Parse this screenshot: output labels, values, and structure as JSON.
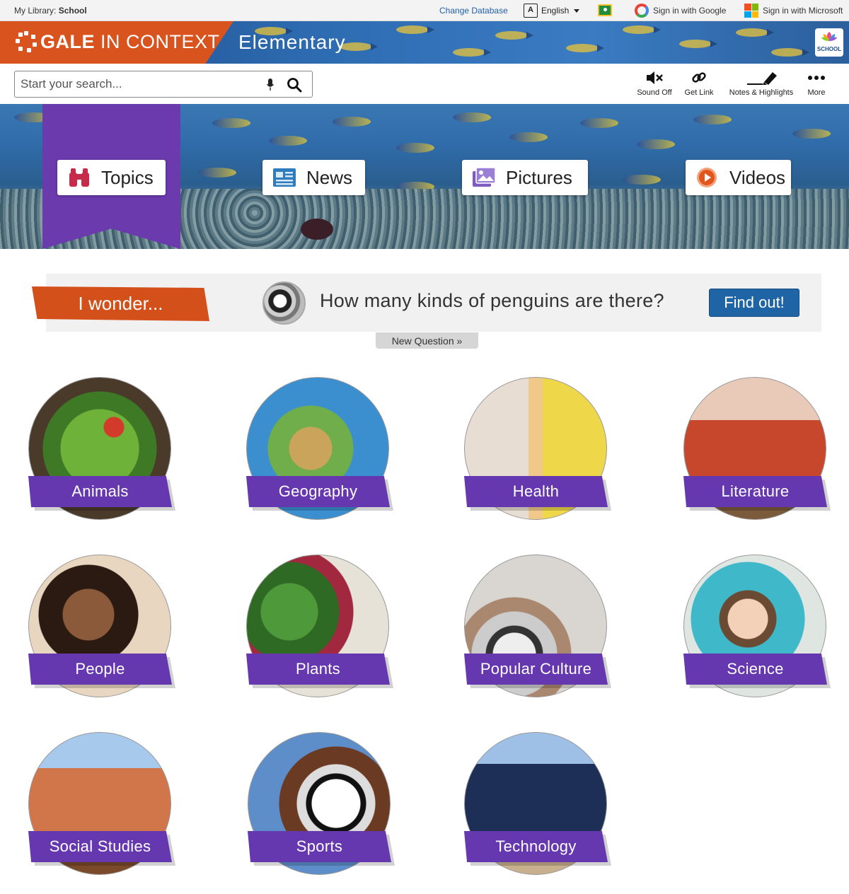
{
  "utility": {
    "library_label": "My Library:",
    "library_name": "School",
    "change_database": "Change Database",
    "language": "English",
    "sign_in_google": "Sign in with Google",
    "sign_in_microsoft": "Sign in with Microsoft"
  },
  "header": {
    "brand_bold": "GALE",
    "brand_rest": "IN CONTEXT",
    "product": "Elementary",
    "badge_text": "SCHOOL",
    "brand_color": "#d9531e"
  },
  "search": {
    "placeholder": "Start your search..."
  },
  "tools": {
    "sound": "Sound Off",
    "link": "Get Link",
    "notes": "Notes & Highlights",
    "more": "More"
  },
  "hero_nav": {
    "accent_color": "#6b3aad",
    "items": [
      {
        "label": "Topics",
        "icon": "binoculars-icon"
      },
      {
        "label": "News",
        "icon": "newspaper-icon"
      },
      {
        "label": "Pictures",
        "icon": "pictures-icon"
      },
      {
        "label": "Videos",
        "icon": "play-icon"
      }
    ]
  },
  "wonder": {
    "tag": "I wonder...",
    "question": "How many kinds of penguins are there?",
    "find_out": "Find out!",
    "new_question": "New Question »",
    "button_color": "#1f64a4"
  },
  "topics": {
    "label_color": "#6638b0",
    "items": [
      {
        "label": "Animals"
      },
      {
        "label": "Geography"
      },
      {
        "label": "Health"
      },
      {
        "label": "Literature"
      },
      {
        "label": "People"
      },
      {
        "label": "Plants"
      },
      {
        "label": "Popular Culture"
      },
      {
        "label": "Science"
      },
      {
        "label": "Social Studies"
      },
      {
        "label": "Sports"
      },
      {
        "label": "Technology"
      }
    ]
  }
}
